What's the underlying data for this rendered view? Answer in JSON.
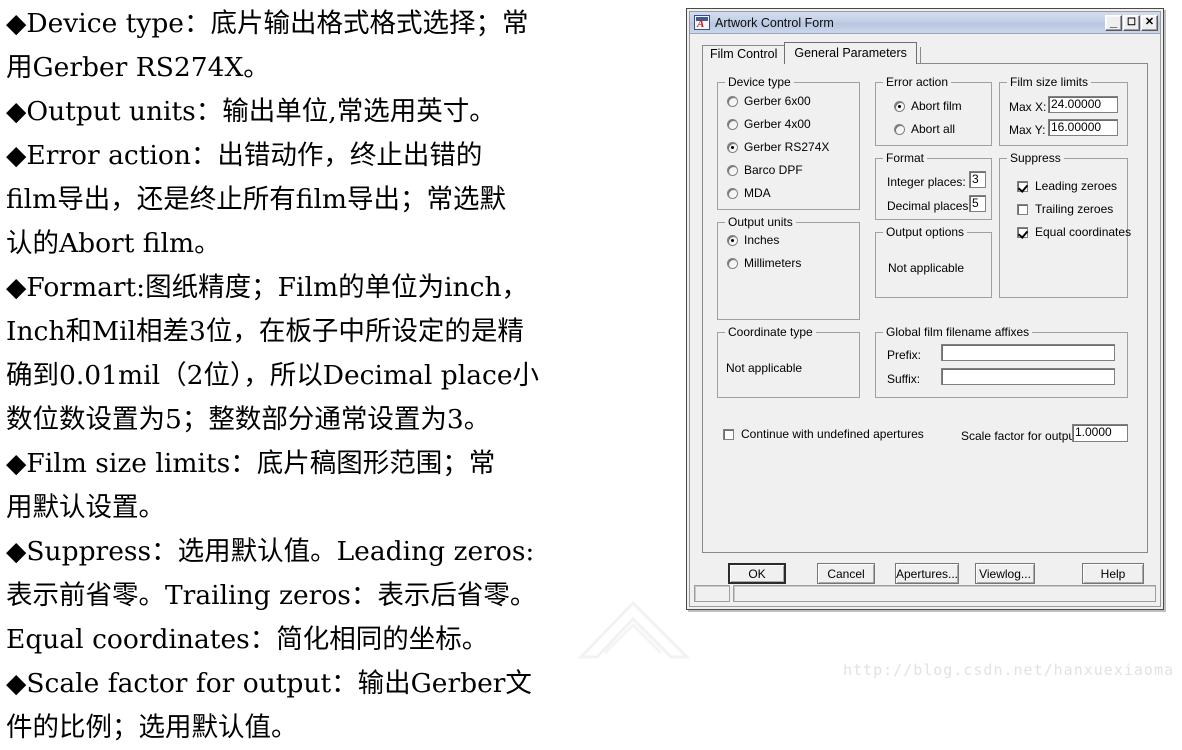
{
  "notes": {
    "lines": [
      "◆Device type：底片输出格式格式选择；常",
      "用Gerber RS274X。",
      "◆Output units：输出单位,常选用英寸。",
      "◆Error action：出错动作，终止出错的",
      "film导出，还是终止所有film导出；常选默",
      "认的Abort film。",
      "◆Formart:图纸精度；Film的单位为inch，",
      "Inch和Mil相差3位，在板子中所设定的是精",
      "确到0.01mil（2位），所以Decimal place小",
      "数位数设置为5；整数部分通常设置为3。",
      "◆Film size limits：底片稿图形范围；常",
      "用默认设置。",
      "◆Suppress：选用默认值。Leading zeros:",
      "表示前省零。Trailing zeros：表示后省零。",
      "Equal coordinates：简化相同的坐标。",
      "◆Scale factor for output：输出Gerber文",
      "件的比例；选用默认值。"
    ]
  },
  "watermark": {
    "url": "http://blog.csdn.net/hanxuexiaoma"
  },
  "window": {
    "title": "Artwork Control Form",
    "icon": "artwork-app-icon",
    "controls": {
      "minimize": "_",
      "maximize": "❐",
      "close": "✕"
    }
  },
  "tabs": [
    {
      "label": "Film Control",
      "active": false
    },
    {
      "label": "General Parameters",
      "active": true
    }
  ],
  "groups": {
    "device_type": {
      "caption": "Device type",
      "options": [
        {
          "label": "Gerber 6x00",
          "selected": false
        },
        {
          "label": "Gerber 4x00",
          "selected": false
        },
        {
          "label": "Gerber RS274X",
          "selected": true
        },
        {
          "label": "Barco DPF",
          "selected": false
        },
        {
          "label": "MDA",
          "selected": false
        }
      ]
    },
    "output_units": {
      "caption": "Output units",
      "options": [
        {
          "label": "Inches",
          "selected": true
        },
        {
          "label": "Millimeters",
          "selected": false
        }
      ]
    },
    "coordinate_type": {
      "caption": "Coordinate type",
      "value": "Not applicable"
    },
    "error_action": {
      "caption": "Error action",
      "options": [
        {
          "label": "Abort film",
          "selected": true
        },
        {
          "label": "Abort all",
          "selected": false
        }
      ]
    },
    "format": {
      "caption": "Format",
      "integer_places_label": "Integer places:",
      "integer_places_value": "3",
      "decimal_places_label": "Decimal places:",
      "decimal_places_value": "5"
    },
    "output_options": {
      "caption": "Output options",
      "value": "Not applicable"
    },
    "film_size_limits": {
      "caption": "Film size limits",
      "max_x_label": "Max X:",
      "max_x_value": "24.00000",
      "max_y_label": "Max Y:",
      "max_y_value": "16.00000"
    },
    "suppress": {
      "caption": "Suppress",
      "options": [
        {
          "label": "Leading zeroes",
          "checked": true
        },
        {
          "label": "Trailing zeroes",
          "checked": false
        },
        {
          "label": "Equal coordinates",
          "checked": true
        }
      ]
    },
    "affixes": {
      "caption": "Global film filename affixes",
      "prefix_label": "Prefix:",
      "prefix_value": "",
      "suffix_label": "Suffix:",
      "suffix_value": ""
    }
  },
  "footer_controls": {
    "continue_undefined": {
      "label": "Continue with undefined apertures",
      "checked": false
    },
    "scale_factor": {
      "label": "Scale factor for output:",
      "value": "1.0000"
    }
  },
  "buttons": [
    {
      "label": "OK",
      "default": true
    },
    {
      "label": "Cancel",
      "default": false
    },
    {
      "label": "Apertures...",
      "default": false
    },
    {
      "label": "Viewlog...",
      "default": false
    },
    {
      "label": "Help",
      "default": false
    }
  ],
  "statusbar": {
    "left_pane": "",
    "right_pane": ""
  },
  "colors": {
    "dialog_face": "#f0f0f0",
    "titlebar": "#c2cfe6",
    "field_bg": "#ffffff",
    "border": "#a0a0a0",
    "text": "#000000"
  }
}
